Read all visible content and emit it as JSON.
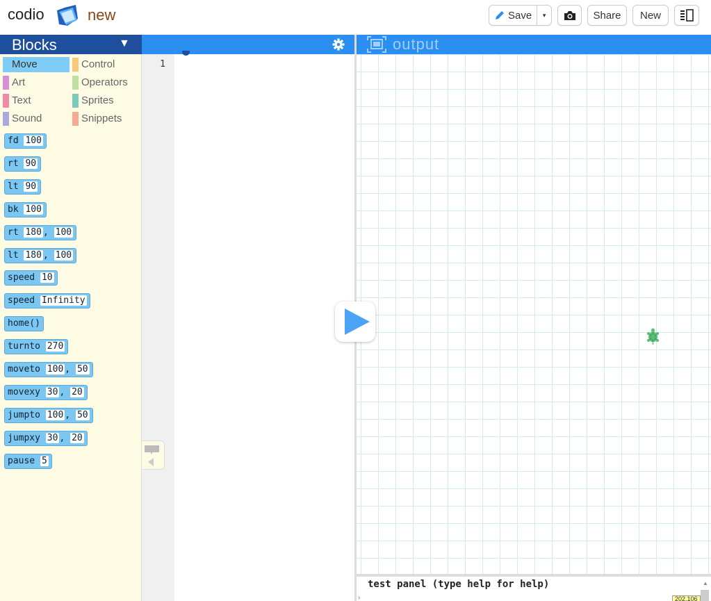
{
  "header": {
    "brand": "codio",
    "project_name": "new",
    "save_label": "Save",
    "save_dropdown_glyph": "▾",
    "share_label": "Share",
    "new_label": "New",
    "icons": [
      "folder-icon",
      "pencil-icon",
      "camera-icon",
      "layout-icon"
    ]
  },
  "blocks": {
    "title": "Blocks",
    "toggle_glyph": "▼",
    "categories": [
      {
        "label": "Move",
        "color": "#7fcdf6",
        "active": true
      },
      {
        "label": "Control",
        "color": "#f9c97b"
      },
      {
        "label": "Art",
        "color": "#d48fd6"
      },
      {
        "label": "Operators",
        "color": "#bfe0a3"
      },
      {
        "label": "Text",
        "color": "#f08aa8"
      },
      {
        "label": "Sprites",
        "color": "#7ac9bb"
      },
      {
        "label": "Sound",
        "color": "#a9a9dd"
      },
      {
        "label": "Snippets",
        "color": "#f7a892"
      }
    ],
    "items": [
      {
        "cmd": "fd",
        "args": [
          "100"
        ]
      },
      {
        "cmd": "rt",
        "args": [
          "90"
        ]
      },
      {
        "cmd": "lt",
        "args": [
          "90"
        ]
      },
      {
        "cmd": "bk",
        "args": [
          "100"
        ]
      },
      {
        "cmd": "rt",
        "args": [
          "180",
          "100"
        ]
      },
      {
        "cmd": "lt",
        "args": [
          "180",
          "100"
        ]
      },
      {
        "cmd": "speed",
        "args": [
          "10"
        ]
      },
      {
        "cmd": "speed",
        "args": [
          "Infinity"
        ]
      },
      {
        "cmd": "home()",
        "args": []
      },
      {
        "cmd": "turnto",
        "args": [
          "270"
        ]
      },
      {
        "cmd": "moveto",
        "args": [
          "100",
          "50"
        ]
      },
      {
        "cmd": "movexy",
        "args": [
          "30",
          "20"
        ]
      },
      {
        "cmd": "jumpto",
        "args": [
          "100",
          "50"
        ]
      },
      {
        "cmd": "jumpxy",
        "args": [
          "30",
          "20"
        ]
      },
      {
        "cmd": "pause",
        "args": [
          "5"
        ]
      }
    ]
  },
  "editor": {
    "line_numbers": [
      "1"
    ],
    "icons": [
      "gear-icon",
      "speech-bubble-icon"
    ]
  },
  "output": {
    "title": "output",
    "icons": [
      "output-frame-icon",
      "play-icon",
      "turtle-icon"
    ]
  },
  "test_panel": {
    "label": "test panel (type help for help)",
    "coord_readout": "202,106"
  },
  "colors": {
    "blocks_header": "#1d4f9c",
    "panel_header": "#2b8ff2",
    "block_fill": "#7cc7f1",
    "grid_line": "#d4ece7",
    "turtle": "#5fbf7a"
  }
}
